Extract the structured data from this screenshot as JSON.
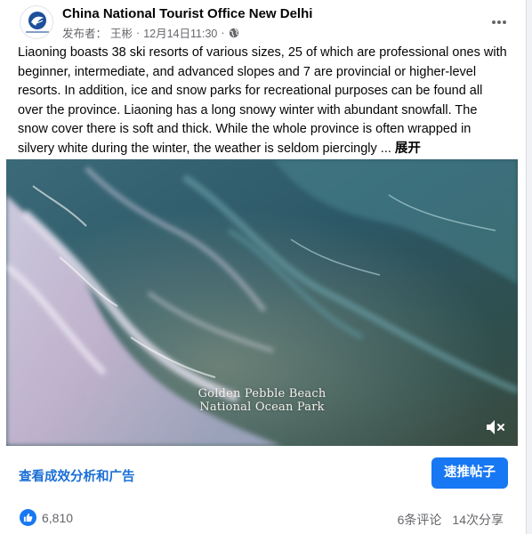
{
  "post": {
    "page_name": "China National Tourist Office New Delhi",
    "publisher_label": "发布者：",
    "publisher_name": "王彬",
    "timestamp": "12月14日11:30",
    "separator": "·",
    "text": "Liaoning boasts 38 ski resorts of various sizes, 25 of which are professional ones with beginner, intermediate, and advanced slopes and 7 are provincial or higher-level resorts. In addition, ice and snow parks for recreational purposes can be found all over the province. Liaoning has a long snowy winter with abundant snowfall. The snow cover there is soft and thick. While the whole province is often wrapped in silvery white during the winter, the weather is seldom piercingly ... ",
    "see_more": "展开"
  },
  "video": {
    "caption_line1": "Golden Pebble Beach",
    "caption_line2": "National Ocean Park",
    "mute_icon": "speaker-muted-icon"
  },
  "actions": {
    "insights_label": "查看成效分析和广告",
    "boost_label": "速推帖子"
  },
  "stats": {
    "like_count": "6,810",
    "comments": "6条评论",
    "shares": "14次分享"
  },
  "colors": {
    "accent": "#1877f2",
    "link": "#1b6fd6",
    "secondary_text": "#65676b"
  },
  "icons": [
    "globe-icon",
    "more-options-icon",
    "like-icon",
    "speaker-muted-icon"
  ]
}
